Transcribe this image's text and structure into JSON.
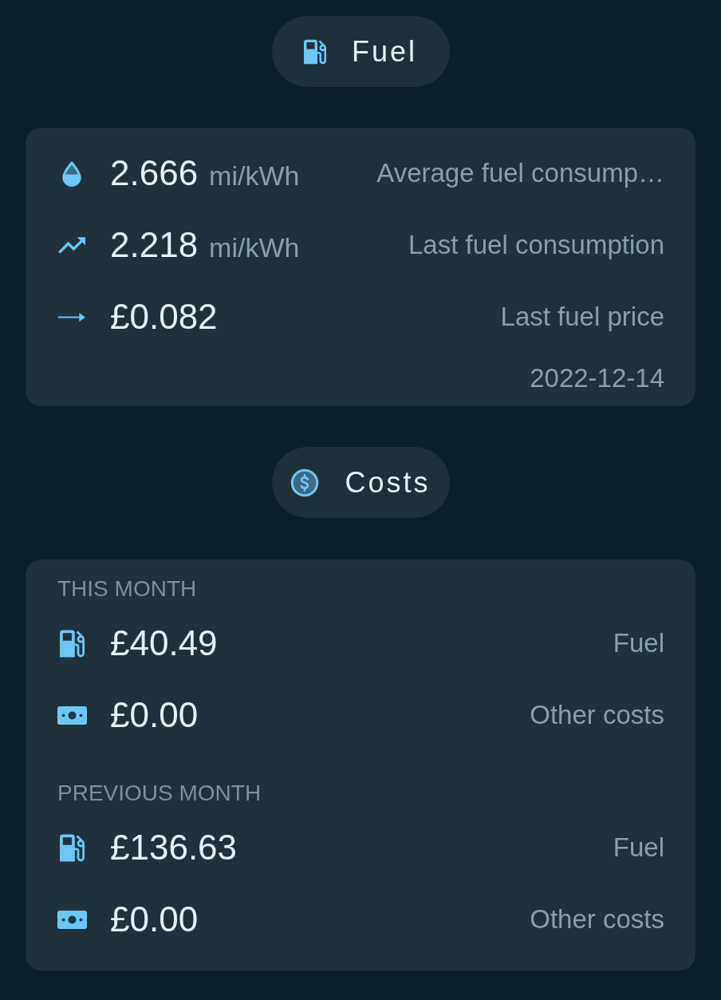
{
  "sections": [
    {
      "kind": "fuel",
      "title": "Fuel",
      "rows": [
        {
          "kind": "average",
          "value": "2.666",
          "unit": "mi/kWh",
          "label": "Average fuel consump…"
        },
        {
          "kind": "last",
          "value": "2.218",
          "unit": "mi/kWh",
          "label": "Last fuel consumption"
        },
        {
          "kind": "price",
          "value": "£0.082",
          "label": "Last fuel price"
        }
      ],
      "date": "2022-12-14"
    },
    {
      "kind": "costs",
      "title": "Costs",
      "groups": [
        {
          "heading": "THIS MONTH",
          "rows": [
            {
              "kind": "fuel",
              "value": "£40.49",
              "label": "Fuel"
            },
            {
              "kind": "other",
              "value": "£0.00",
              "label": "Other costs"
            }
          ]
        },
        {
          "heading": "PREVIOUS MONTH",
          "rows": [
            {
              "kind": "fuel",
              "value": "£136.63",
              "label": "Fuel"
            },
            {
              "kind": "other",
              "value": "£0.00",
              "label": "Other costs"
            }
          ]
        }
      ]
    }
  ]
}
